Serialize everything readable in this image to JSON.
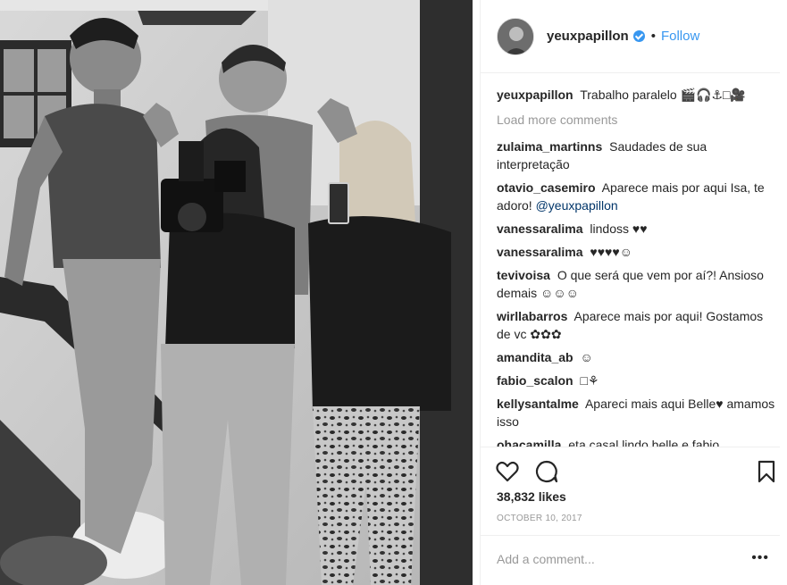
{
  "post": {
    "username": "yeuxpapillon",
    "verified_icon": "verified-badge-icon",
    "separator": "•",
    "follow_label": "Follow",
    "caption_user": "yeuxpapillon",
    "caption_text": "Trabalho paralelo 🎬🎧⚓□🎥"
  },
  "load_more_label": "Load more comments",
  "comments": [
    {
      "user": "zulaima_martinns",
      "text": "Saudades de sua interpretação"
    },
    {
      "user": "otavio_casemiro",
      "text": "Aparece mais por aqui Isa, te adoro! ",
      "mention": "@yeuxpapillon"
    },
    {
      "user": "vanessaralima",
      "text": "lindoss ♥♥"
    },
    {
      "user": "vanessaralima",
      "text": "♥♥♥♥☺"
    },
    {
      "user": "tevivoisa",
      "text": "O que será que vem por aí?! Ansioso demais ☺☺☺"
    },
    {
      "user": "wirllabarros",
      "text": "Aparece mais por aqui! Gostamos de vc ✿✿✿"
    },
    {
      "user": "amandita_ab",
      "text": "☺"
    },
    {
      "user": "fabio_scalon",
      "text": "□⚘"
    },
    {
      "user": "kellysantalme",
      "text": "Apareci mais aqui Belle♥ amamos isso"
    },
    {
      "user": "ohacamilla",
      "text": "eta casal lindo belle e fabio"
    }
  ],
  "actions": {
    "like_icon": "heart-icon",
    "comment_icon": "comment-bubble-icon",
    "save_icon": "bookmark-icon"
  },
  "likes_text": "38,832 likes",
  "date_text": "OCTOBER 10, 2017",
  "comment_placeholder": "Add a comment...",
  "more_label": "•••"
}
